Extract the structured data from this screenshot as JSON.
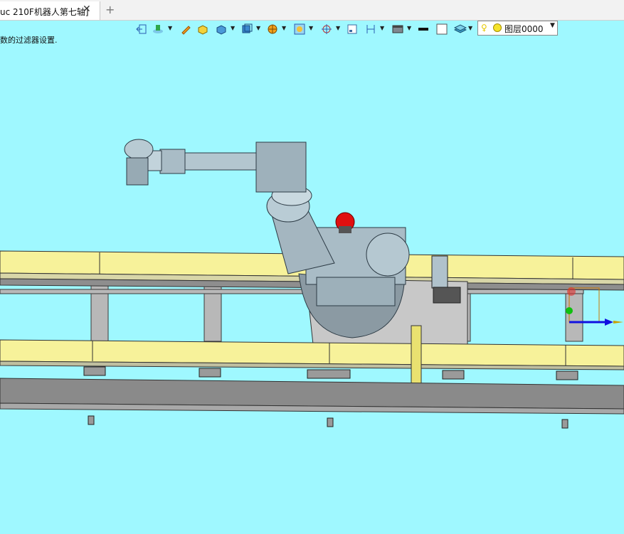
{
  "tab": {
    "title": "uc 210F机器人第七轴]",
    "close_glyph": "✕",
    "add_glyph": "+"
  },
  "hint_text": "数的过滤器设置.",
  "toolbar": {
    "icons": [
      "exit-sketch-icon",
      "render-mode-icon",
      "pencil-edit-icon",
      "solid-yellow-box-icon",
      "shaded-box-icon",
      "view-cube-icon",
      "section-icon",
      "sphere-display-icon",
      "move-axis-icon",
      "frame-icon",
      "dimension-icon",
      "display-style-icon",
      "black-line-icon",
      "white-fill-icon",
      "layers-stack-icon"
    ]
  },
  "layer": {
    "name": "图层0000",
    "bulb_icon": "lightbulb-icon",
    "sun_icon": "layer-active-icon"
  },
  "colors": {
    "background": "#9ff8ff",
    "rail_yellow": "#f7f29a",
    "robot_gray": "#9fb2bc",
    "beam_gray": "#8a8a8a",
    "emergency_red": "#e01010"
  }
}
